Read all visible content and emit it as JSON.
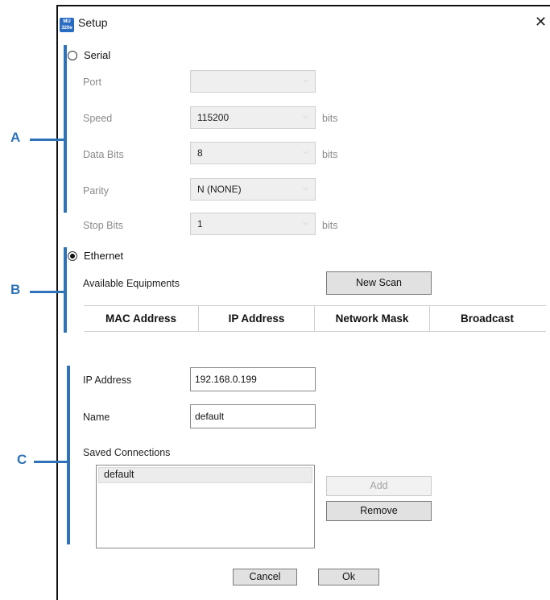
{
  "window": {
    "title": "Setup",
    "app_icon_text": "MU 320e",
    "close_glyph": "✕"
  },
  "callouts": {
    "a": "A",
    "b": "B",
    "c": "C"
  },
  "serial": {
    "label": "Serial",
    "selected": false,
    "fields": {
      "port": {
        "label": "Port",
        "value": "",
        "unit": ""
      },
      "speed": {
        "label": "Speed",
        "value": "115200",
        "unit": "bits"
      },
      "data_bits": {
        "label": "Data Bits",
        "value": "8",
        "unit": "bits"
      },
      "parity": {
        "label": "Parity",
        "value": "N (NONE)",
        "unit": ""
      },
      "stop_bits": {
        "label": "Stop Bits",
        "value": "1",
        "unit": "bits"
      }
    },
    "dropdown_glyph": "⌵"
  },
  "ethernet": {
    "label": "Ethernet",
    "selected": true,
    "available_label": "Available Equipments",
    "new_scan_label": "New Scan",
    "columns": [
      "MAC Address",
      "IP Address",
      "Network Mask",
      "Broadcast"
    ]
  },
  "connection": {
    "ip_label": "IP Address",
    "ip_value": "192.168.0.199",
    "name_label": "Name",
    "name_value": "default",
    "saved_label": "Saved Connections",
    "saved_items": [
      "default"
    ],
    "add_label": "Add",
    "remove_label": "Remove"
  },
  "footer": {
    "cancel_label": "Cancel",
    "ok_label": "Ok"
  }
}
